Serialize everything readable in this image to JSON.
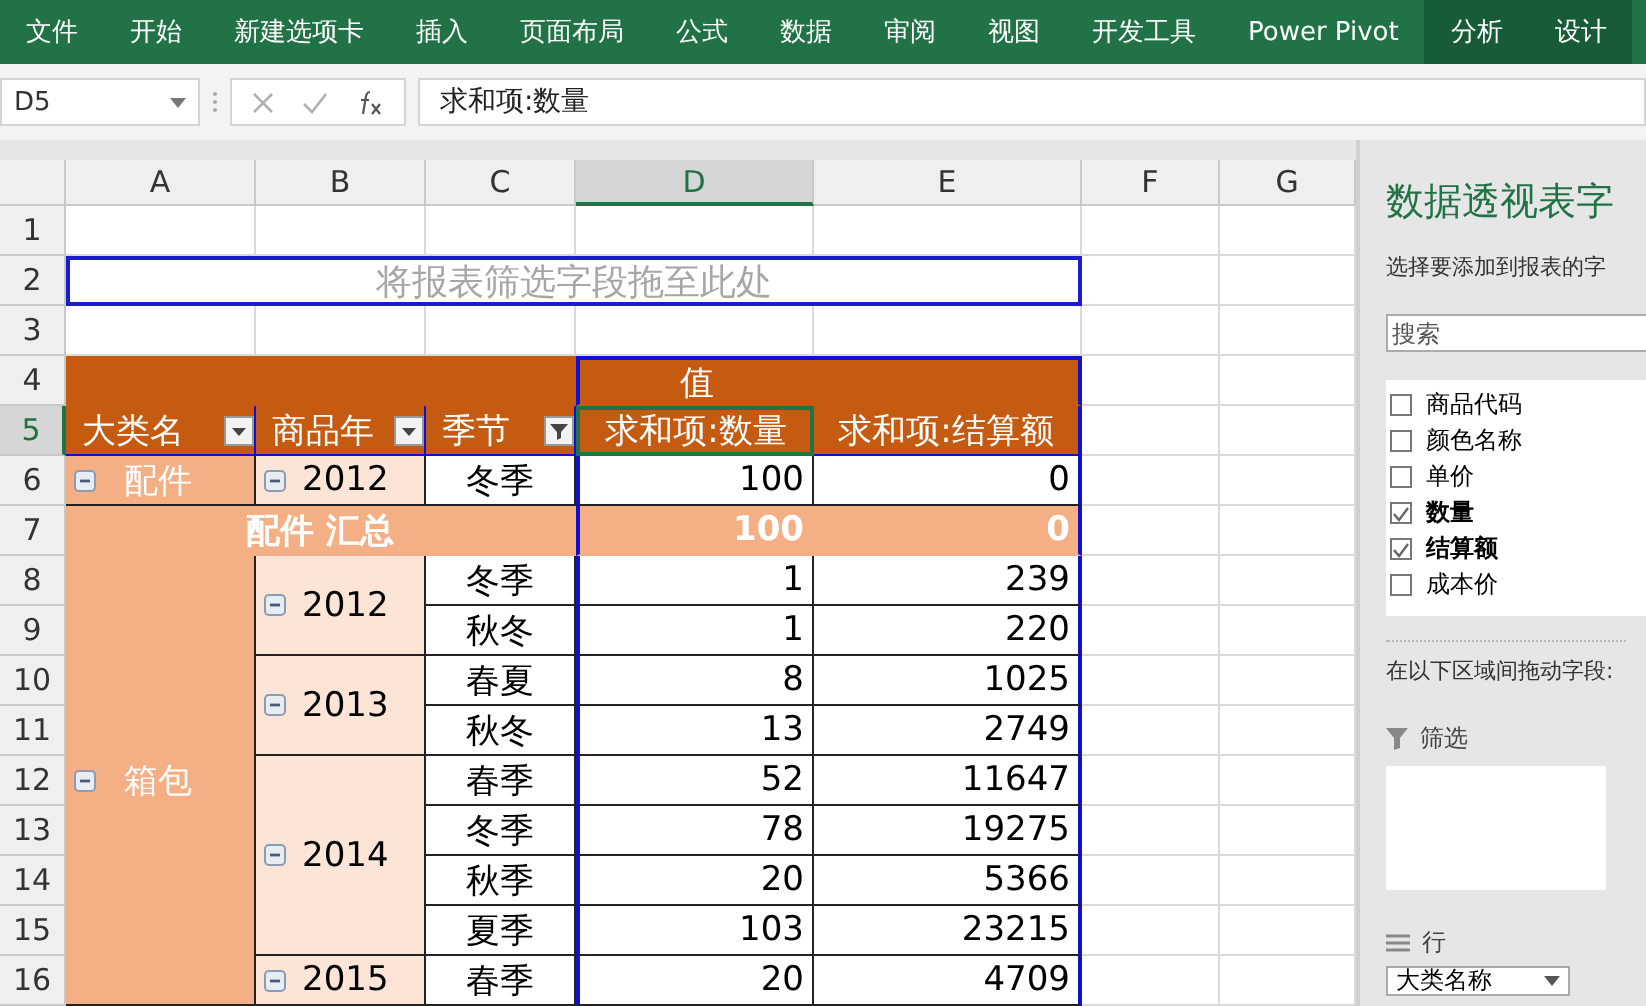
{
  "ribbon_tabs": [
    {
      "label": "文件",
      "contextual": false
    },
    {
      "label": "开始",
      "contextual": false
    },
    {
      "label": "新建选项卡",
      "contextual": false
    },
    {
      "label": "插入",
      "contextual": false
    },
    {
      "label": "页面布局",
      "contextual": false
    },
    {
      "label": "公式",
      "contextual": false
    },
    {
      "label": "数据",
      "contextual": false
    },
    {
      "label": "审阅",
      "contextual": false
    },
    {
      "label": "视图",
      "contextual": false
    },
    {
      "label": "开发工具",
      "contextual": false
    },
    {
      "label": "Power Pivot",
      "contextual": false
    },
    {
      "label": "分析",
      "contextual": true
    },
    {
      "label": "设计",
      "contextual": true
    }
  ],
  "formula_bar": {
    "name_box": "D5",
    "formula": "求和项:数量"
  },
  "sheet": {
    "columns": [
      {
        "label": "A",
        "selected": false
      },
      {
        "label": "B",
        "selected": false
      },
      {
        "label": "C",
        "selected": false
      },
      {
        "label": "D",
        "selected": true
      },
      {
        "label": "E",
        "selected": false
      },
      {
        "label": "F",
        "selected": false
      },
      {
        "label": "G",
        "selected": false
      }
    ],
    "rows": [
      {
        "label": "1",
        "selected": false
      },
      {
        "label": "2",
        "selected": false
      },
      {
        "label": "3",
        "selected": false
      },
      {
        "label": "4",
        "selected": false
      },
      {
        "label": "5",
        "selected": true
      },
      {
        "label": "6",
        "selected": false
      },
      {
        "label": "7",
        "selected": false
      },
      {
        "label": "8",
        "selected": false
      },
      {
        "label": "9",
        "selected": false
      },
      {
        "label": "10",
        "selected": false
      },
      {
        "label": "11",
        "selected": false
      },
      {
        "label": "12",
        "selected": false
      },
      {
        "label": "13",
        "selected": false
      },
      {
        "label": "14",
        "selected": false
      },
      {
        "label": "15",
        "selected": false
      },
      {
        "label": "16",
        "selected": false
      }
    ],
    "filter_drop_zone": "将报表筛选字段拖至此处"
  },
  "pivot": {
    "values_header": "值",
    "headers": [
      {
        "label": "大类名",
        "filtered": false,
        "active": false
      },
      {
        "label": "商品年",
        "filtered": false,
        "active": false
      },
      {
        "label": "季节",
        "filtered": true,
        "active": false
      },
      {
        "label": "求和项:数量",
        "active": true
      },
      {
        "label": "求和项:结算额",
        "active": false
      }
    ],
    "groups": [
      {
        "category": "配件",
        "years": [
          {
            "year": "2012",
            "rows": [
              {
                "season": "冬季",
                "quantity": "100",
                "amount": "0"
              }
            ]
          }
        ],
        "subtotal": {
          "label": "配件 汇总",
          "quantity": "100",
          "amount": "0"
        }
      },
      {
        "category": "箱包",
        "years": [
          {
            "year": "2012",
            "rows": [
              {
                "season": "冬季",
                "quantity": "1",
                "amount": "239"
              },
              {
                "season": "秋冬",
                "quantity": "1",
                "amount": "220"
              }
            ]
          },
          {
            "year": "2013",
            "rows": [
              {
                "season": "春夏",
                "quantity": "8",
                "amount": "1025"
              },
              {
                "season": "秋冬",
                "quantity": "13",
                "amount": "2749"
              }
            ]
          },
          {
            "year": "2014",
            "rows": [
              {
                "season": "春季",
                "quantity": "52",
                "amount": "11647"
              },
              {
                "season": "冬季",
                "quantity": "78",
                "amount": "19275"
              },
              {
                "season": "秋季",
                "quantity": "20",
                "amount": "5366"
              },
              {
                "season": "夏季",
                "quantity": "103",
                "amount": "23215"
              }
            ]
          },
          {
            "year": "2015",
            "rows": [
              {
                "season": "春季",
                "quantity": "20",
                "amount": "4709"
              }
            ]
          }
        ]
      }
    ]
  },
  "pivot_pane": {
    "title": "数据透视表字",
    "subtitle": "选择要添加到报表的字",
    "search": {
      "placeholder": "搜索"
    },
    "fields": [
      {
        "label": "商品代码",
        "checked": false
      },
      {
        "label": "颜色名称",
        "checked": false
      },
      {
        "label": "单价",
        "checked": false
      },
      {
        "label": "数量",
        "checked": true
      },
      {
        "label": "结算额",
        "checked": true
      },
      {
        "label": "成本价",
        "checked": false
      }
    ],
    "areas_label": "在以下区域间拖动字段:",
    "areas": [
      {
        "kind": "filter",
        "label": "筛选"
      },
      {
        "kind": "rows",
        "label": "行",
        "items": [
          "大类名称"
        ]
      }
    ]
  }
}
